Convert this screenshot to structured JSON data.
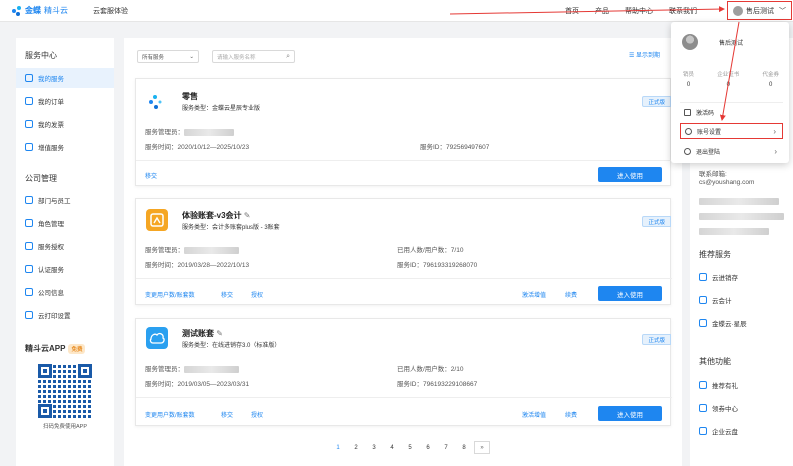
{
  "header": {
    "logo_text": "金蝶",
    "logo_sub": "精斗云",
    "subtitle": "云套服体验",
    "nav": [
      "首页",
      "产品",
      "帮助中心",
      "联系我们"
    ],
    "user": "售后测试"
  },
  "sidebar": {
    "section1": "服务中心",
    "items1": [
      "我的服务",
      "我的订单",
      "我的发票",
      "增值服务"
    ],
    "section2": "公司管理",
    "items2": [
      "部门与员工",
      "角色管理",
      "服务授权",
      "认证服务",
      "公司信息",
      "云打印设置"
    ],
    "app_title": "精斗云APP",
    "app_badge": "免费",
    "qr_caption": "扫码免费使用APP"
  },
  "main": {
    "filter_select": "所有服务",
    "search_placeholder": "请输入服务名称",
    "show_expired": "显示到期",
    "cards": [
      {
        "title": "零售",
        "type": "服务类型：金蝶云星辰专业版",
        "edition": "正式版",
        "admin_label": "服务管理员：",
        "time": "服务时间：2020/10/12—2025/10/23",
        "id": "服务ID：792569497607",
        "links": [
          "移交"
        ],
        "enter": "进入使用"
      },
      {
        "title": "体验账套-v3会计",
        "type": "服务类型：会计多账套plus版 - 3账套",
        "edition": "正式版",
        "admin_label": "服务管理员：",
        "users": "已用人数/用户数：7/10",
        "time": "服务时间：2019/03/28—2022/10/13",
        "id": "服务ID：796193319268070",
        "links": [
          "变更用户数/账套数",
          "移交",
          "授权"
        ],
        "right_links": [
          "激活增值",
          "续费"
        ],
        "enter": "进入使用"
      },
      {
        "title": "测试账套",
        "type": "服务类型：在线进销存3.0（标准版）",
        "edition": "正式版",
        "admin_label": "服务管理员：",
        "users": "已用人数/用户数：2/10",
        "time": "服务时间：2019/03/05—2023/03/31",
        "id": "服务ID：796193229108667",
        "links": [
          "变更用户数/账套数",
          "移交",
          "授权"
        ],
        "right_links": [
          "激活增值",
          "续费"
        ],
        "enter": "进入使用"
      }
    ],
    "pages": [
      "1",
      "2",
      "3",
      "4",
      "5",
      "6",
      "7",
      "8",
      "»"
    ]
  },
  "right": {
    "email_label": "联系邮箱:",
    "email": "cs@youshang.com",
    "recommend_title": "推荐服务",
    "recommend": [
      "云进销存",
      "云会计",
      "金蝶云·星辰"
    ],
    "other_title": "其他功能",
    "other": [
      "推荐有礼",
      "领券中心",
      "企业云盘"
    ]
  },
  "dropdown": {
    "name": "售后测试",
    "stats": [
      {
        "label": "销员",
        "value": "0"
      },
      {
        "label": "企业证书",
        "value": "0"
      },
      {
        "label": "代金券",
        "value": "0"
      }
    ],
    "activation": "激活码",
    "account_settings": "账号设置",
    "logout": "退出登陆"
  },
  "colors": {
    "accent": "#1e86f0",
    "highlight": "#e53935"
  }
}
